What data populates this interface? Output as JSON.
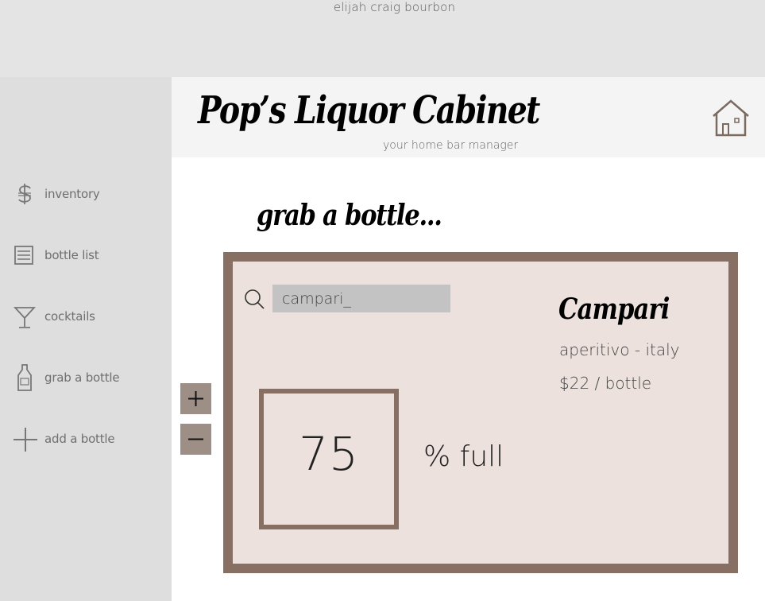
{
  "top_tab": "elijah craig bourbon",
  "header": {
    "title": "Pop’s Liquor Cabinet",
    "subtitle": "your home bar manager"
  },
  "sidebar": {
    "items": [
      {
        "label": "inventory",
        "icon": "dollar-icon"
      },
      {
        "label": "bottle list",
        "icon": "list-icon"
      },
      {
        "label": "cocktails",
        "icon": "cocktail-glass-icon"
      },
      {
        "label": "grab a bottle",
        "icon": "bottle-icon"
      },
      {
        "label": "add a bottle",
        "icon": "plus-icon"
      }
    ]
  },
  "main": {
    "section_title": "grab a bottle...",
    "search_value": "campari_",
    "percent_value": "75",
    "percent_unit": "% full",
    "bottle": {
      "name": "Campari",
      "category": "aperitivo - italy",
      "price": "$22 / bottle"
    }
  },
  "colors": {
    "accent": "#876f63",
    "card_bg": "#ece1dc",
    "button_bg": "#9e8f86",
    "sidebar_bg": "#dedede",
    "header_bg": "#f4f4f4",
    "topbar_bg": "#e4e4e4"
  }
}
